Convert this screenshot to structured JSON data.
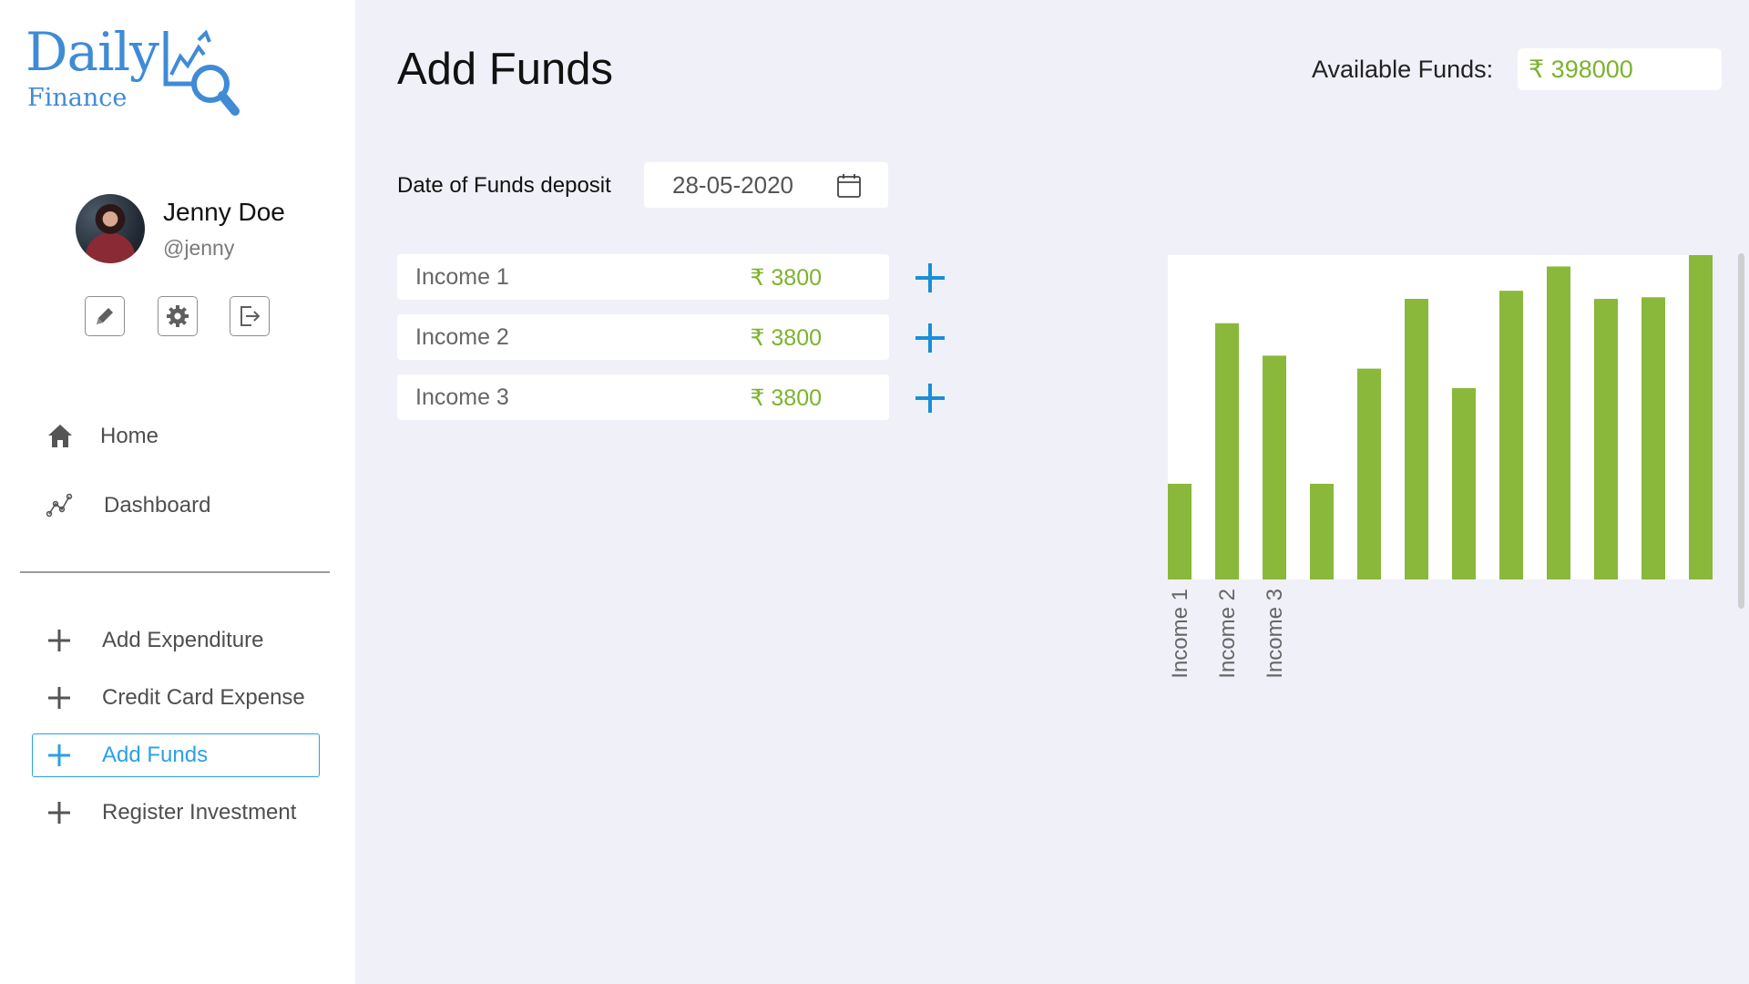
{
  "app": {
    "logo_word": "Daily",
    "logo_subword": "Finance",
    "logo_mark_icon": "chart-magnifier-icon",
    "brand_color": "#3f8bd6"
  },
  "profile": {
    "name": "Jenny Doe",
    "handle": "@jenny",
    "actions": [
      "pencil-icon",
      "gear-icon",
      "logout-icon"
    ]
  },
  "nav": {
    "items": [
      {
        "label": "Home",
        "icon": "home-icon"
      },
      {
        "label": "Dashboard",
        "icon": "trend-line-icon"
      }
    ]
  },
  "actions": {
    "items": [
      {
        "label": "Add Expenditure",
        "icon": "plus-icon",
        "active": false
      },
      {
        "label": "Credit Card Expense",
        "icon": "plus-icon",
        "active": false
      },
      {
        "label": "Add Funds",
        "icon": "plus-icon",
        "active": true
      },
      {
        "label": "Register Investment",
        "icon": "plus-icon",
        "active": false
      }
    ],
    "active_color": "#2aa0e6"
  },
  "page": {
    "title": "Add Funds",
    "available_label": "Available Funds:",
    "available_value": "₹ 398000"
  },
  "deposit": {
    "label": "Date of Funds deposit",
    "date_value": "28-05-2020",
    "date_icon": "calendar-icon"
  },
  "incomes": [
    {
      "label": "Income 1",
      "amount": "₹ 3800"
    },
    {
      "label": "Income 2",
      "amount": "₹ 3800"
    },
    {
      "label": "Income 3",
      "amount": "₹ 3800"
    }
  ],
  "colors": {
    "amount_green": "#7cb32e",
    "bar_green": "#8ab83a",
    "add_blue": "#1a8fd6"
  },
  "chart_data": {
    "type": "bar",
    "categories": [
      "Income 1",
      "Income 2",
      "Income 3",
      "",
      "",
      "",
      "",
      "",
      "",
      "",
      "",
      ""
    ],
    "values": [
      29.5,
      79,
      69,
      29.5,
      65,
      86.5,
      59,
      89,
      96.5,
      86.5,
      87,
      100
    ],
    "title": "",
    "xlabel": "",
    "ylabel": "",
    "ylim": [
      0,
      100
    ],
    "grid": false,
    "legend": "none"
  }
}
